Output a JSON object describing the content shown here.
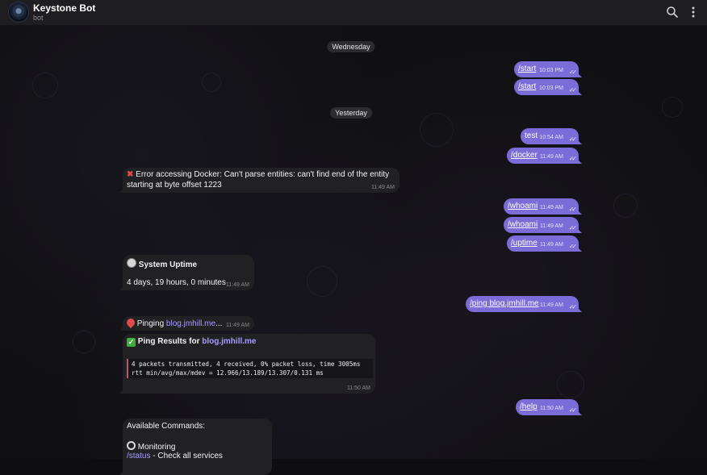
{
  "header": {
    "title": "Keystone Bot",
    "subtitle": "bot",
    "search_icon": "search-icon",
    "menu_icon": "kebab-menu-icon"
  },
  "dates": {
    "wednesday": "Wednesday",
    "yesterday": "Yesterday"
  },
  "messages": {
    "start1": {
      "text": "/start",
      "time": "10:03 PM"
    },
    "start2": {
      "text": "/start",
      "time": "10:03 PM"
    },
    "test": {
      "text": "test",
      "time": "10:54 AM"
    },
    "docker": {
      "text": "/docker",
      "time": "11:49 AM"
    },
    "docker_error": {
      "line1": "Error accessing Docker: Can't parse entities: can't find end of the entity",
      "line2": "starting at byte offset 1223",
      "time": "11:49 AM"
    },
    "whoami1": {
      "text": "/whoami",
      "time": "11:49 AM"
    },
    "whoami2": {
      "text": "/whoami",
      "time": "11:49 AM"
    },
    "uptime": {
      "text": "/uptime",
      "time": "11:49 AM"
    },
    "uptime_reply": {
      "title": "System Uptime",
      "value": "4 days, 19 hours, 0 minutes",
      "time": "11:49 AM"
    },
    "ping": {
      "command": "/ping",
      "host": "blog.jmhill.me",
      "time": "11:49 AM"
    },
    "pinging": {
      "prefix": "Pinging",
      "host": "blog.jmhill.me",
      "suffix": "...",
      "time": "11:49 AM"
    },
    "ping_results": {
      "title": "Ping Results for",
      "host": "blog.jmhill.me",
      "line1": "4 packets transmitted, 4 received, 0% packet loss, time 3005ms",
      "line2": "rtt min/avg/max/mdev = 12.966/13.189/13.307/0.131 ms",
      "time": "11:50 AM"
    },
    "help": {
      "text": "/help",
      "time": "11:50 AM"
    },
    "commands": {
      "title": "Available Commands:",
      "section": "Monitoring",
      "first_cmd": "/status",
      "first_desc": " - Check all services"
    }
  },
  "colors": {
    "outgoing_bubble": "#7c6cd8",
    "incoming_bubble": "#212124",
    "link": "#a89cff"
  }
}
